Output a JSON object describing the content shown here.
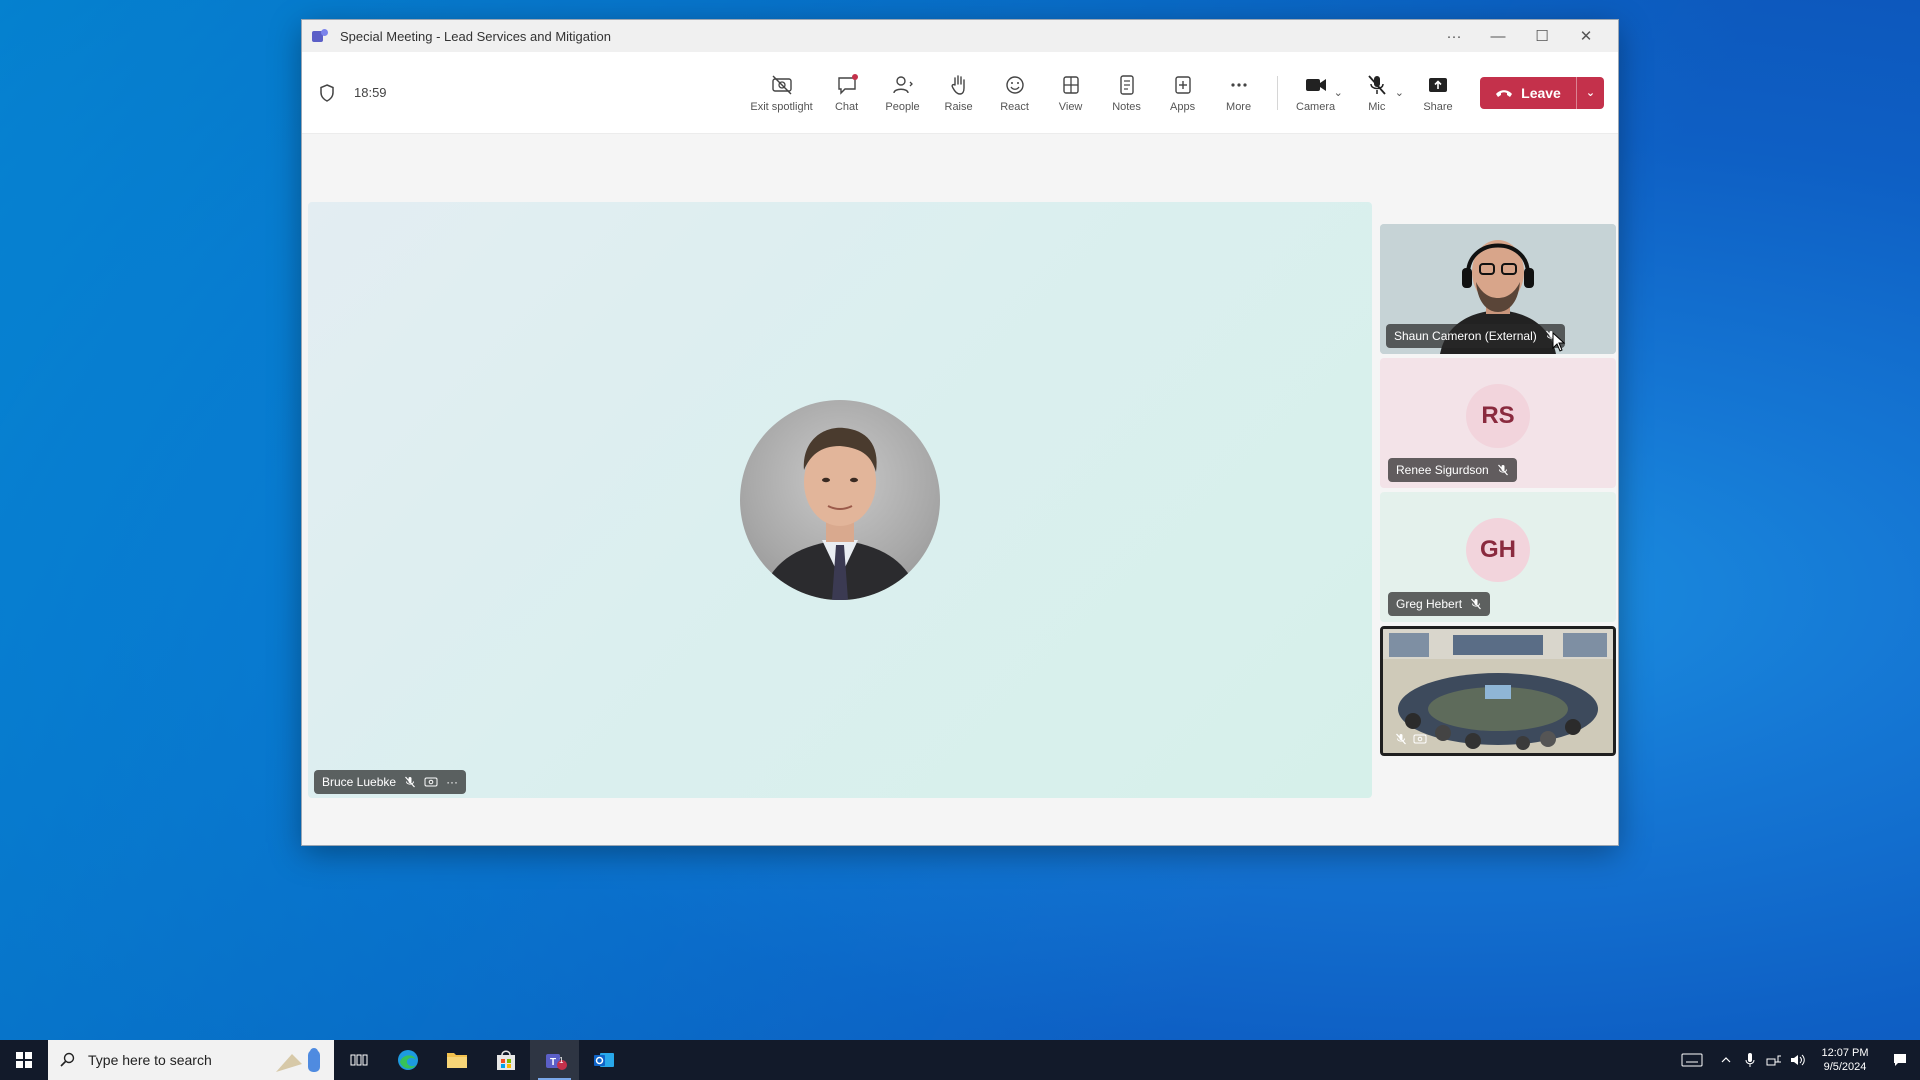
{
  "window": {
    "title": "Special Meeting - Lead Services and Mitigation",
    "more_label": "···",
    "minimize_label": "—",
    "maximize_label": "☐",
    "close_label": "✕"
  },
  "toolbar": {
    "timer": "18:59",
    "tools": [
      {
        "name": "exit-spotlight",
        "label": "Exit spotlight",
        "icon": "spotlight-off-icon"
      },
      {
        "name": "chat",
        "label": "Chat",
        "icon": "chat-icon"
      },
      {
        "name": "people",
        "label": "People",
        "icon": "people-icon"
      },
      {
        "name": "raise",
        "label": "Raise",
        "icon": "hand-icon"
      },
      {
        "name": "react",
        "label": "React",
        "icon": "emoji-icon"
      },
      {
        "name": "view",
        "label": "View",
        "icon": "grid-icon"
      },
      {
        "name": "notes",
        "label": "Notes",
        "icon": "notes-icon"
      },
      {
        "name": "apps",
        "label": "Apps",
        "icon": "apps-icon"
      },
      {
        "name": "more",
        "label": "More",
        "icon": "more-icon"
      }
    ],
    "camera_label": "Camera",
    "mic_label": "Mic",
    "share_label": "Share",
    "leave_label": "Leave",
    "leave_color": "#c4314b"
  },
  "main_participant": {
    "name": "Bruce Luebke",
    "more_label": "···"
  },
  "side_participants": [
    {
      "name": "Shaun Cameron (External)",
      "type": "video"
    },
    {
      "name": "Renee Sigurdson",
      "initials": "RS",
      "type": "avatar",
      "bg": "#f3e3e8",
      "avatar_bg": "#f2d4dc",
      "avatar_fg": "#8a2a3e"
    },
    {
      "name": "Greg Hebert",
      "initials": "GH",
      "type": "avatar",
      "bg": "#e4f1ec",
      "avatar_bg": "#f2d4dc",
      "avatar_fg": "#8a2a3e"
    },
    {
      "name": "",
      "type": "room"
    }
  ],
  "taskbar": {
    "search_placeholder": "Type here to search",
    "time": "12:07 PM",
    "date": "9/5/2024",
    "apps": [
      "task-view",
      "edge",
      "file-explorer",
      "store",
      "teams",
      "outlook"
    ],
    "teams_badge": "1"
  }
}
